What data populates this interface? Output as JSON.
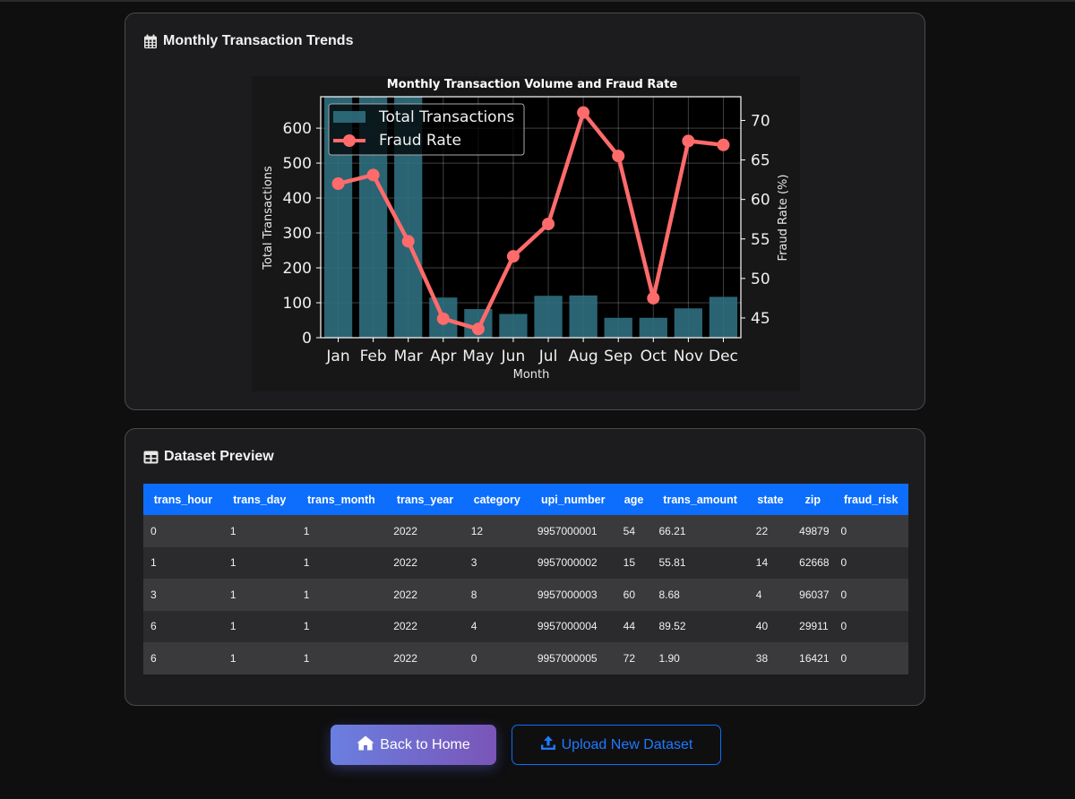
{
  "trends_card": {
    "title": "Monthly Transaction Trends"
  },
  "preview_card": {
    "title": "Dataset Preview"
  },
  "buttons": {
    "home_label": "Back to Home",
    "upload_label": "Upload New Dataset"
  },
  "colors": {
    "accent": "#0d6efd",
    "bar": "#2f6f80",
    "line": "#ff6b6b",
    "card_bg": "#1c1c1e"
  },
  "chart_data": {
    "type": "bar",
    "title": "Monthly Transaction Volume and Fraud Rate",
    "xlabel": "Month",
    "ylabel": "Total Transactions",
    "ylabel_right": "Fraud Rate (%)",
    "categories": [
      "Jan",
      "Feb",
      "Mar",
      "Apr",
      "May",
      "Jun",
      "Jul",
      "Aug",
      "Sep",
      "Oct",
      "Nov",
      "Dec"
    ],
    "ylim": [
      0,
      690
    ],
    "yticks": [
      0,
      100,
      200,
      300,
      400,
      500,
      600
    ],
    "ylim_right": [
      42.5,
      73
    ],
    "yticks_right": [
      45,
      50,
      55,
      60,
      65,
      70
    ],
    "grid": true,
    "legend": "top-left",
    "series": [
      {
        "name": "Total Transactions",
        "type": "bar",
        "axis": "left",
        "values": [
          690,
          690,
          690,
          115,
          82,
          68,
          120,
          121,
          57,
          57,
          84,
          117
        ]
      },
      {
        "name": "Fraud Rate",
        "type": "line",
        "axis": "right",
        "values": [
          62.0,
          63.1,
          54.7,
          44.9,
          43.6,
          52.8,
          56.9,
          71.0,
          65.5,
          47.5,
          67.4,
          66.9
        ]
      }
    ]
  },
  "table": {
    "columns": [
      "trans_hour",
      "trans_day",
      "trans_month",
      "trans_year",
      "category",
      "upi_number",
      "age",
      "trans_amount",
      "state",
      "zip",
      "fraud_risk"
    ],
    "rows": [
      [
        "0",
        "1",
        "1",
        "2022",
        "12",
        "9957000001",
        "54",
        "66.21",
        "22",
        "49879",
        "0"
      ],
      [
        "1",
        "1",
        "1",
        "2022",
        "3",
        "9957000002",
        "15",
        "55.81",
        "14",
        "62668",
        "0"
      ],
      [
        "3",
        "1",
        "1",
        "2022",
        "8",
        "9957000003",
        "60",
        "8.68",
        "4",
        "96037",
        "0"
      ],
      [
        "6",
        "1",
        "1",
        "2022",
        "4",
        "9957000004",
        "44",
        "89.52",
        "40",
        "29911",
        "0"
      ],
      [
        "6",
        "1",
        "1",
        "2022",
        "0",
        "9957000005",
        "72",
        "1.90",
        "38",
        "16421",
        "0"
      ]
    ]
  }
}
